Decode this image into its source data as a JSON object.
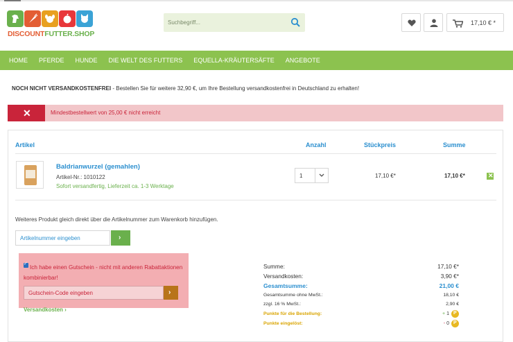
{
  "header": {
    "logo_text_part1": "DISCOUNT",
    "logo_text_part2": "FUTTER.SHOP",
    "logo_colors": [
      "#6ab04c",
      "#e35d33",
      "#e8a020",
      "#e8373a",
      "#3ba3d6"
    ],
    "search_placeholder": "Suchbegriff...",
    "cart_amount": "17,10 € *",
    "icons": [
      "search-icon",
      "heart-icon",
      "user-icon",
      "cart-icon"
    ]
  },
  "nav": {
    "items": [
      "HOME",
      "PFERDE",
      "HUNDE",
      "DIE WELT DES FUTTERS",
      "EQUELLA-KRÄUTERSÄFTE",
      "ANGEBOTE"
    ]
  },
  "notice": {
    "bold": "NOCH NICHT VERSANDKOSTENFREI",
    "text": " - Bestellen Sie für weitere 32,90 €, um Ihre Bestellung versandkostenfrei in Deutschland zu erhalten!"
  },
  "alert": {
    "message": "Mindestbestellwert von 25,00 € nicht erreicht",
    "icon": "close-icon"
  },
  "cart_table": {
    "headers": {
      "article": "Artikel",
      "quantity": "Anzahl",
      "unit_price": "Stückpreis",
      "sum": "Summe"
    },
    "items": [
      {
        "name": "Baldrianwurzel (gemahlen)",
        "article_nr": "Artikel-Nr.: 1010122",
        "availability": "Sofort versandfertig, Lieferzeit ca. 1-3 Werktage",
        "quantity": "1",
        "unit_price": "17,10 €*",
        "sum": "17,10 €*"
      }
    ]
  },
  "add_product": {
    "text": "Weiteres Produkt gleich direkt über die Artikelnummer zum Warenkorb hinzufügen.",
    "placeholder": "Artikelnummer eingeben",
    "button_label": "›"
  },
  "voucher": {
    "checkbox_label": "Ich habe einen Gutschein - nicht mit anderen Rabattaktionen kombinierbar!",
    "placeholder": "Gutschein-Code eingeben",
    "button_label": "›",
    "checked": true
  },
  "shipping_link": "Versandkosten ›",
  "summary": {
    "summe_label": "Summe:",
    "summe_value": "17,10 €*",
    "versand_label": "Versandkosten:",
    "versand_value": "3,90 €*",
    "gesamt_label": "Gesamtsumme:",
    "gesamt_value": "21,00 €",
    "netto_label": "Gesamtsumme ohne MwSt.:",
    "netto_value": "18,10 €",
    "mwst_label": "zzgl. 16 % MwSt.:",
    "mwst_value": "2,90 €",
    "points_order_label": "Punkte für die Bestellung:",
    "points_order_sign": "+",
    "points_order_value": "1",
    "points_redeemed_label": "Punkte eingelöst:",
    "points_redeemed_sign": "-",
    "points_redeemed_value": "0",
    "coin_letter": "P"
  }
}
